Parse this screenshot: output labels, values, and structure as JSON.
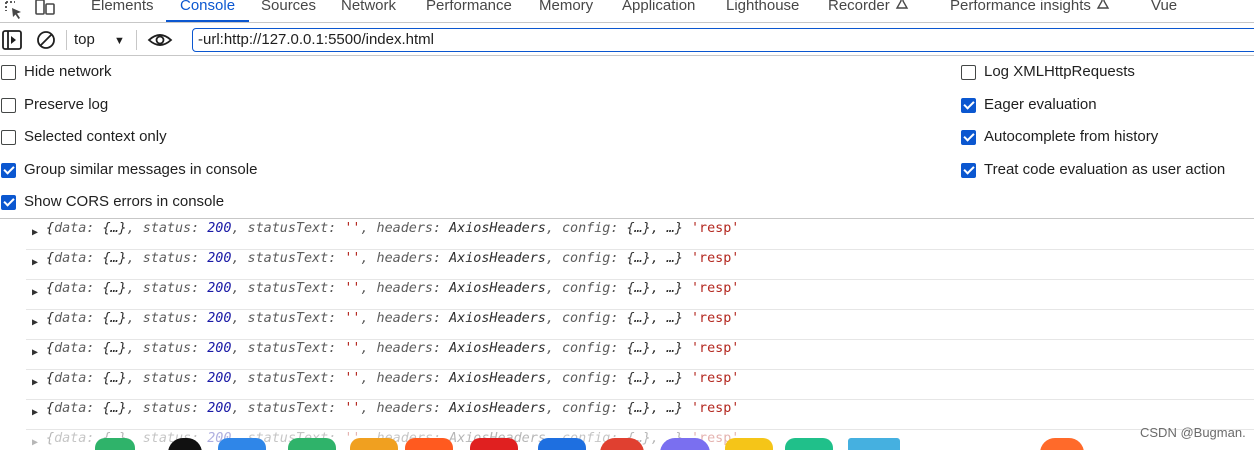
{
  "tabs": [
    {
      "label": "Elements",
      "active": false
    },
    {
      "label": "Console",
      "active": true
    },
    {
      "label": "Sources",
      "active": false
    },
    {
      "label": "Network",
      "active": false
    },
    {
      "label": "Performance",
      "active": false
    },
    {
      "label": "Memory",
      "active": false
    },
    {
      "label": "Application",
      "active": false
    },
    {
      "label": "Lighthouse",
      "active": false
    },
    {
      "label": "Recorder",
      "active": false,
      "icon": "flask-icon"
    },
    {
      "label": "Performance insights",
      "active": false,
      "icon": "flask-icon"
    },
    {
      "label": "Vue",
      "active": false
    }
  ],
  "toolbar": {
    "context": "top",
    "filter_value": "-url:http://127.0.0.1:5500/index.html"
  },
  "settings": {
    "left": [
      {
        "label": "Hide network",
        "checked": false
      },
      {
        "label": "Preserve log",
        "checked": false
      },
      {
        "label": "Selected context only",
        "checked": false
      },
      {
        "label": "Group similar messages in console",
        "checked": true
      },
      {
        "label": "Show CORS errors in console",
        "checked": true
      }
    ],
    "right": [
      {
        "label": "Log XMLHttpRequests",
        "checked": false
      },
      {
        "label": "Eager evaluation",
        "checked": true
      },
      {
        "label": "Autocomplete from history",
        "checked": true
      },
      {
        "label": "Treat code evaluation as user action",
        "checked": true
      }
    ]
  },
  "messages": {
    "parts": {
      "open": "{",
      "data_key": "data: ",
      "data_val": "{…}",
      "status_key": ", status: ",
      "status_val": "200",
      "statustext_key": ", statusText: ",
      "statustext_val": "''",
      "headers_key": ", headers: ",
      "headers_val": "AxiosHeaders",
      "config_key": ", config: ",
      "config_val": "{…}",
      "rest": ", …}",
      "tag": "'resp'"
    },
    "count": 8
  },
  "watermark": "CSDN @Bugman.",
  "colors": {
    "accent": "#0b57d0",
    "string": "#b3261e",
    "number": "#1a1aa6"
  }
}
